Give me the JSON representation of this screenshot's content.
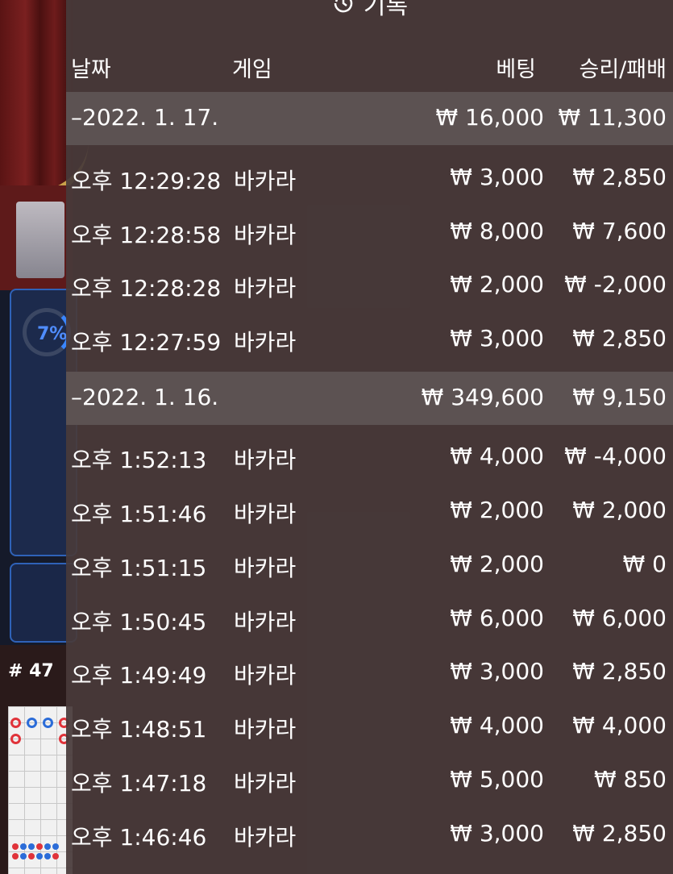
{
  "header": {
    "title": "기록",
    "icon": "history-icon"
  },
  "columns": {
    "date": "날짜",
    "game": "게임",
    "bet": "베팅",
    "win_loss": "승리/패배"
  },
  "side": {
    "percent": "7%",
    "round_label": "# 47"
  },
  "groups": [
    {
      "date": "–2022. 1. 17.",
      "bet_total": "₩ 16,000",
      "wl_total": "₩ 11,300",
      "rows": [
        {
          "time": "오후 12:29:28",
          "game": "바카라",
          "bet": "₩ 3,000",
          "wl": "₩ 2,850"
        },
        {
          "time": "오후 12:28:58",
          "game": "바카라",
          "bet": "₩ 8,000",
          "wl": "₩ 7,600"
        },
        {
          "time": "오후 12:28:28",
          "game": "바카라",
          "bet": "₩ 2,000",
          "wl": "₩ -2,000"
        },
        {
          "time": "오후 12:27:59",
          "game": "바카라",
          "bet": "₩ 3,000",
          "wl": "₩ 2,850"
        }
      ]
    },
    {
      "date": "–2022. 1. 16.",
      "bet_total": "₩ 349,600",
      "wl_total": "₩ 9,150",
      "rows": [
        {
          "time": "오후 1:52:13",
          "game": "바카라",
          "bet": "₩ 4,000",
          "wl": "₩ -4,000"
        },
        {
          "time": "오후 1:51:46",
          "game": "바카라",
          "bet": "₩ 2,000",
          "wl": "₩ 2,000"
        },
        {
          "time": "오후 1:51:15",
          "game": "바카라",
          "bet": "₩ 2,000",
          "wl": "₩ 0"
        },
        {
          "time": "오후 1:50:45",
          "game": "바카라",
          "bet": "₩ 6,000",
          "wl": "₩ 6,000"
        },
        {
          "time": "오후 1:49:49",
          "game": "바카라",
          "bet": "₩ 3,000",
          "wl": "₩ 2,850"
        },
        {
          "time": "오후 1:48:51",
          "game": "바카라",
          "bet": "₩ 4,000",
          "wl": "₩ 4,000"
        },
        {
          "time": "오후 1:47:18",
          "game": "바카라",
          "bet": "₩ 5,000",
          "wl": "₩ 850"
        },
        {
          "time": "오후 1:46:46",
          "game": "바카라",
          "bet": "₩ 3,000",
          "wl": "₩ 2,850"
        }
      ]
    }
  ],
  "colors": {
    "panel": "#483a3a",
    "group_bar": "#5c5252",
    "accent_blue": "#3a86ff"
  }
}
